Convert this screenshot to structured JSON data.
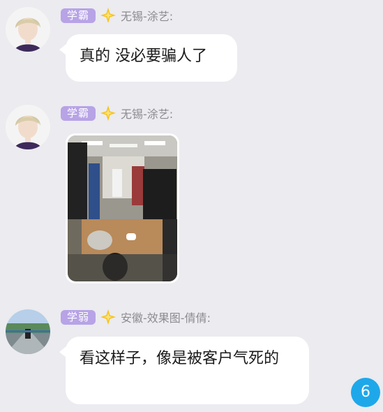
{
  "messages": [
    {
      "badge": "学霸",
      "sender": "无锡-涂艺:",
      "text": "真的 没必要骗人了"
    },
    {
      "badge": "学霸",
      "sender": "无锡-涂艺:",
      "image": "office-photo"
    },
    {
      "badge": "学弱",
      "sender": "安徽-效果图-倩倩:",
      "text": "看这样子，像是被客户气死的"
    }
  ],
  "unread_count": "6",
  "colors": {
    "background": "#ebebf0",
    "badge": "#b7a3e6",
    "nickname": "#8b8b90",
    "unread_badge": "#1ea8ea"
  },
  "icons": [
    "avatar",
    "rank-star-icon",
    "photo-thumbnail"
  ]
}
